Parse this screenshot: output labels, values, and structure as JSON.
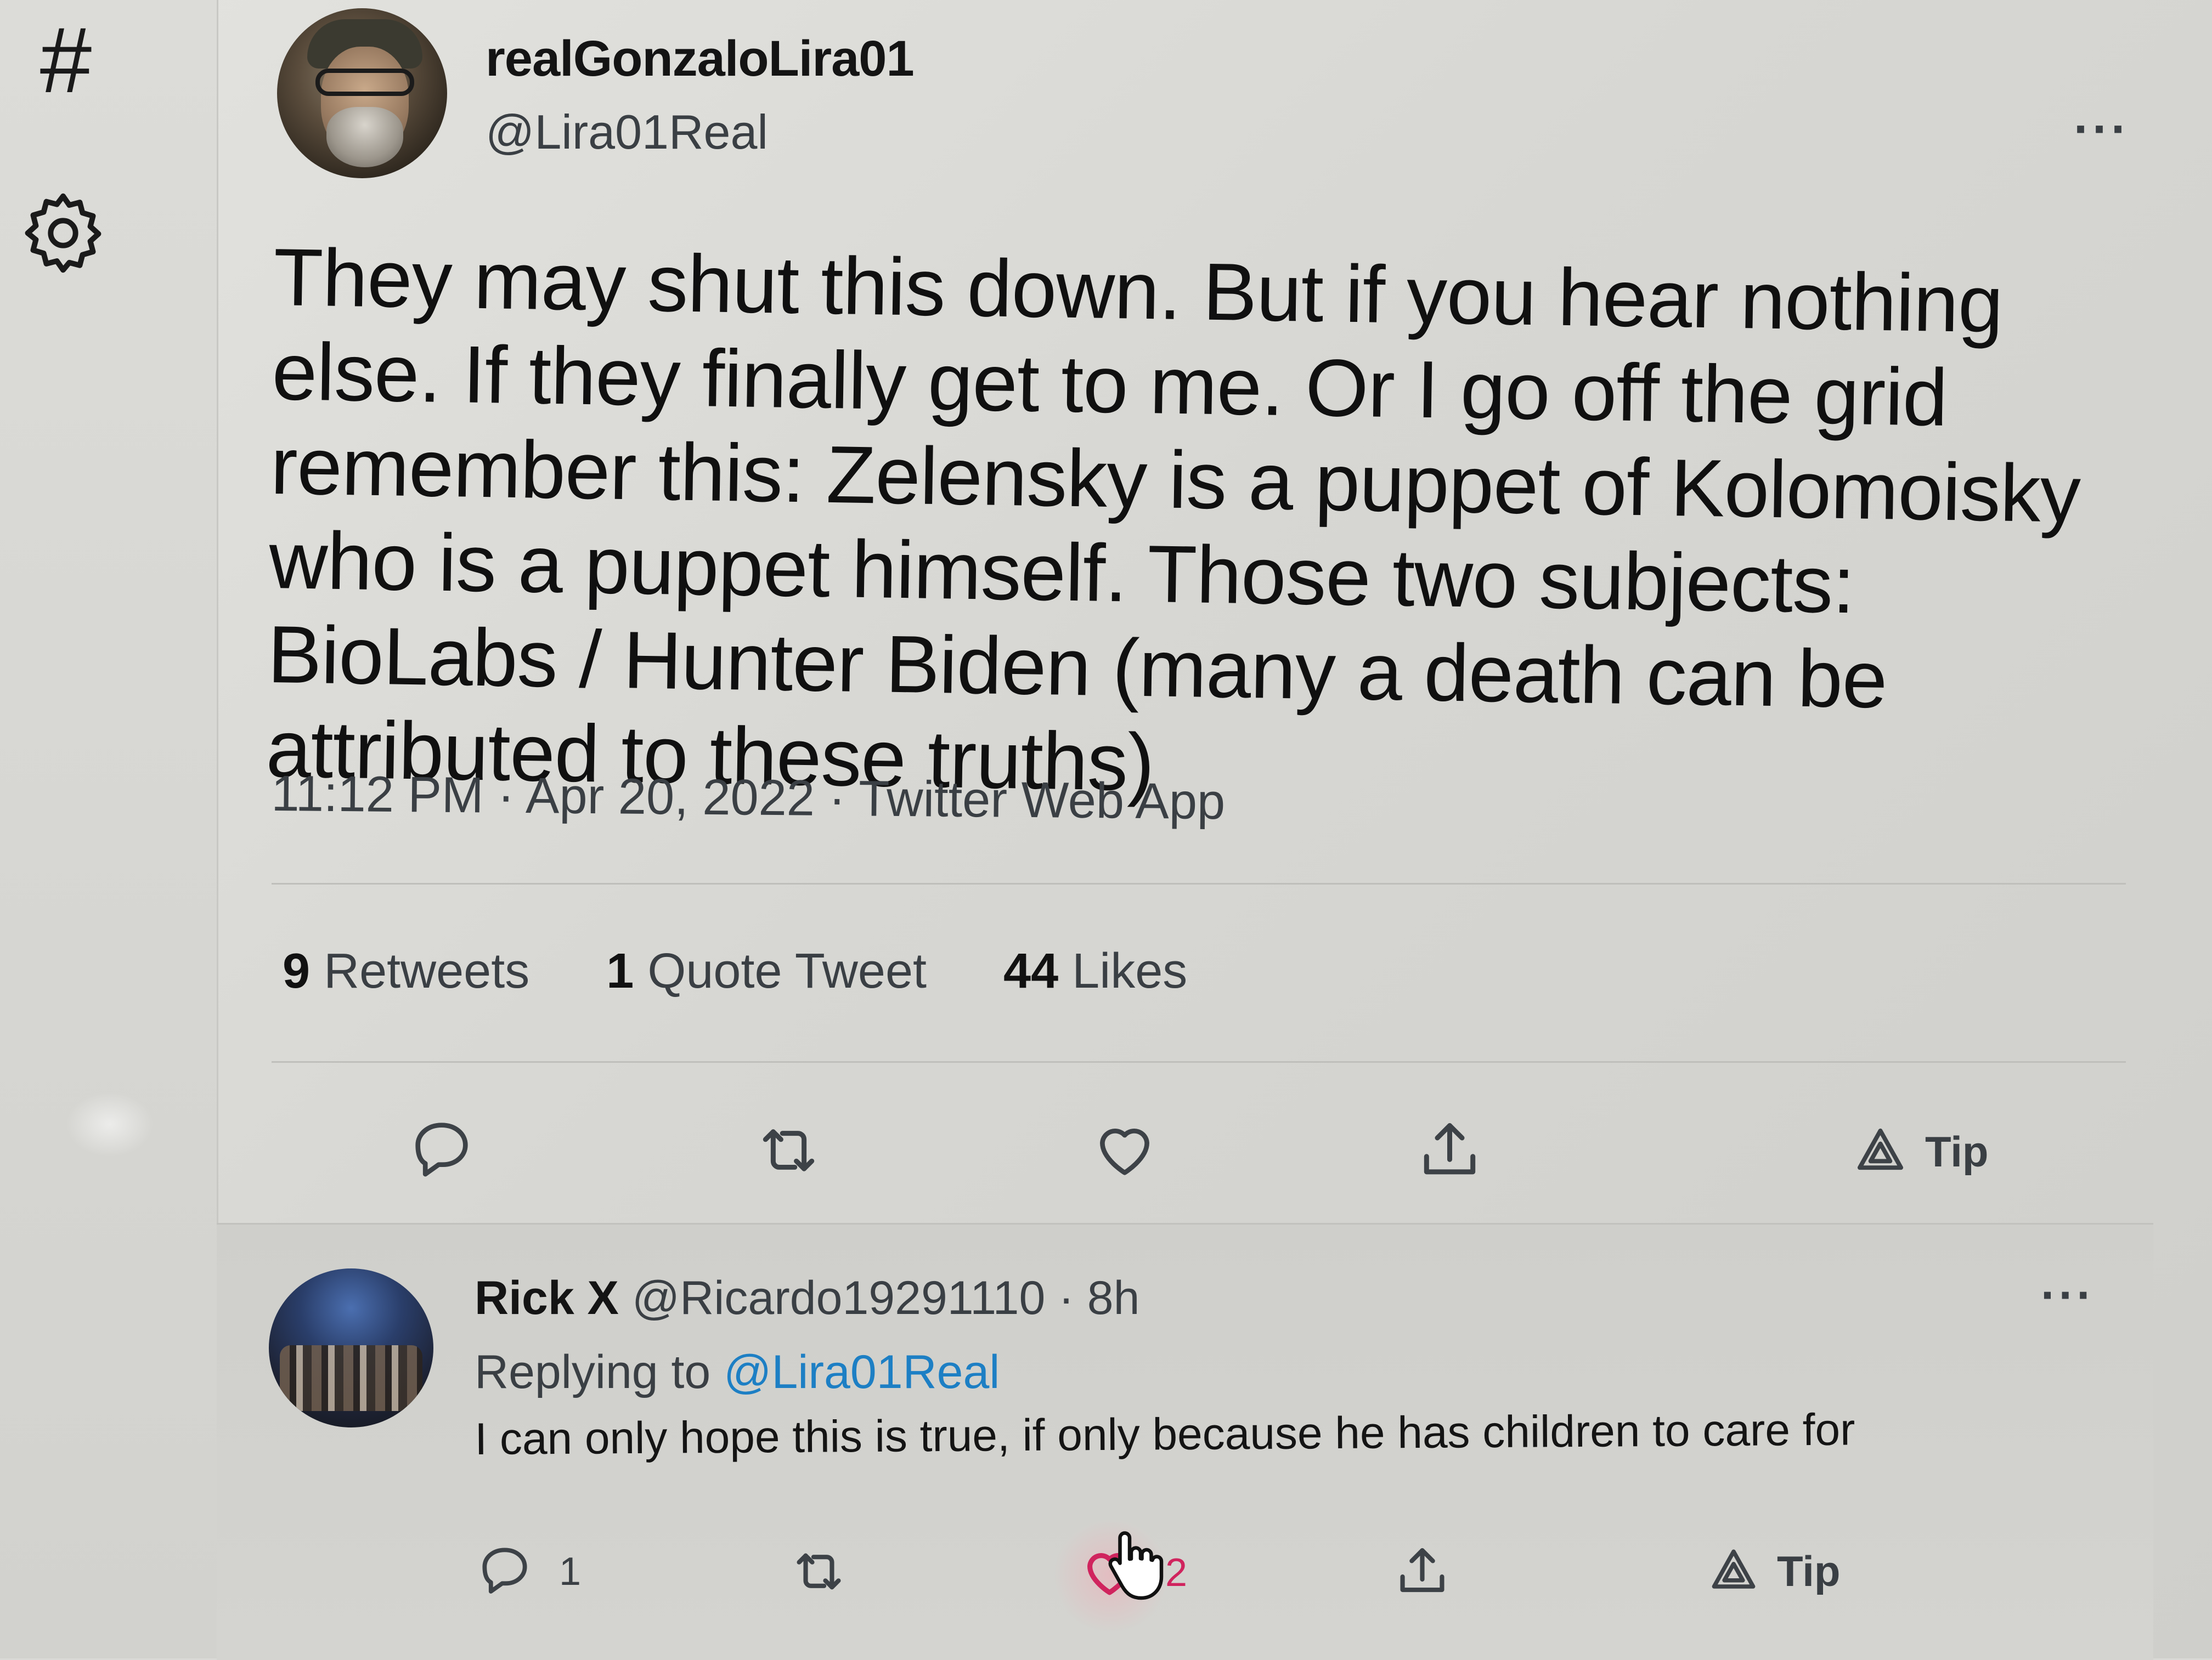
{
  "nav": {
    "items": [
      {
        "icon": "hashtag-icon",
        "glyph": "#"
      },
      {
        "icon": "gear-icon"
      }
    ]
  },
  "tweet": {
    "display_name": "realGonzaloLira01",
    "handle": "@Lira01Real",
    "more_label": "···",
    "text": "They may shut this down. But if you hear nothing else. If they finally get to me. Or I go off the grid remember this: Zelensky is a puppet of Kolomoisky who is a puppet himself. Those two subjects: BioLabs / Hunter Biden (many a death can be attributed to these truths)",
    "meta": "11:12 PM · Apr 20, 2022 · Twitter Web App",
    "stats": {
      "retweets_count": "9",
      "retweets_label": "Retweets",
      "quotes_count": "1",
      "quotes_label": "Quote Tweet",
      "likes_count": "44",
      "likes_label": "Likes"
    },
    "actions": {
      "reply_icon": "reply-icon",
      "retweet_icon": "retweet-icon",
      "like_icon": "heart-icon",
      "share_icon": "share-icon",
      "tip_icon": "tip-icon",
      "tip_label": "Tip"
    }
  },
  "reply": {
    "display_name": "Rick X",
    "handle": "@Ricardo19291110",
    "separator": "·",
    "time": "8h",
    "more_label": "···",
    "replying_prefix": "Replying to",
    "replying_to": "@Lira01Real",
    "text": "I can only hope this is true, if only because he has children to care for",
    "reply_count": "1",
    "like_count": "2",
    "tip_label": "Tip"
  },
  "colors": {
    "link": "#1d7fc4",
    "like": "#d0245e",
    "text": "#101010",
    "muted": "#3a3f44"
  }
}
